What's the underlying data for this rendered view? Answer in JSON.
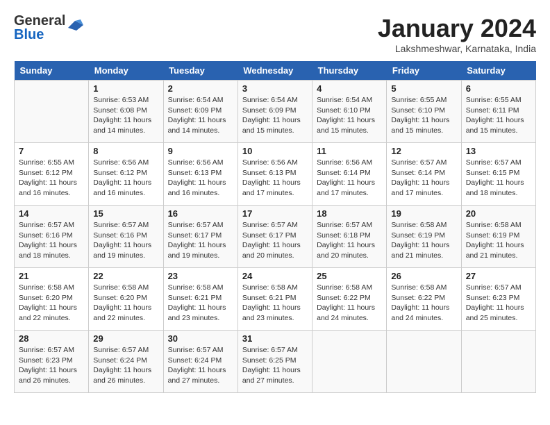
{
  "header": {
    "logo_general": "General",
    "logo_blue": "Blue",
    "month_title": "January 2024",
    "location": "Lakshmeshwar, Karnataka, India"
  },
  "weekdays": [
    "Sunday",
    "Monday",
    "Tuesday",
    "Wednesday",
    "Thursday",
    "Friday",
    "Saturday"
  ],
  "weeks": [
    [
      {
        "day": "",
        "info": ""
      },
      {
        "day": "1",
        "info": "Sunrise: 6:53 AM\nSunset: 6:08 PM\nDaylight: 11 hours\nand 14 minutes."
      },
      {
        "day": "2",
        "info": "Sunrise: 6:54 AM\nSunset: 6:09 PM\nDaylight: 11 hours\nand 14 minutes."
      },
      {
        "day": "3",
        "info": "Sunrise: 6:54 AM\nSunset: 6:09 PM\nDaylight: 11 hours\nand 15 minutes."
      },
      {
        "day": "4",
        "info": "Sunrise: 6:54 AM\nSunset: 6:10 PM\nDaylight: 11 hours\nand 15 minutes."
      },
      {
        "day": "5",
        "info": "Sunrise: 6:55 AM\nSunset: 6:10 PM\nDaylight: 11 hours\nand 15 minutes."
      },
      {
        "day": "6",
        "info": "Sunrise: 6:55 AM\nSunset: 6:11 PM\nDaylight: 11 hours\nand 15 minutes."
      }
    ],
    [
      {
        "day": "7",
        "info": "Sunrise: 6:55 AM\nSunset: 6:12 PM\nDaylight: 11 hours\nand 16 minutes."
      },
      {
        "day": "8",
        "info": "Sunrise: 6:56 AM\nSunset: 6:12 PM\nDaylight: 11 hours\nand 16 minutes."
      },
      {
        "day": "9",
        "info": "Sunrise: 6:56 AM\nSunset: 6:13 PM\nDaylight: 11 hours\nand 16 minutes."
      },
      {
        "day": "10",
        "info": "Sunrise: 6:56 AM\nSunset: 6:13 PM\nDaylight: 11 hours\nand 17 minutes."
      },
      {
        "day": "11",
        "info": "Sunrise: 6:56 AM\nSunset: 6:14 PM\nDaylight: 11 hours\nand 17 minutes."
      },
      {
        "day": "12",
        "info": "Sunrise: 6:57 AM\nSunset: 6:14 PM\nDaylight: 11 hours\nand 17 minutes."
      },
      {
        "day": "13",
        "info": "Sunrise: 6:57 AM\nSunset: 6:15 PM\nDaylight: 11 hours\nand 18 minutes."
      }
    ],
    [
      {
        "day": "14",
        "info": "Sunrise: 6:57 AM\nSunset: 6:16 PM\nDaylight: 11 hours\nand 18 minutes."
      },
      {
        "day": "15",
        "info": "Sunrise: 6:57 AM\nSunset: 6:16 PM\nDaylight: 11 hours\nand 19 minutes."
      },
      {
        "day": "16",
        "info": "Sunrise: 6:57 AM\nSunset: 6:17 PM\nDaylight: 11 hours\nand 19 minutes."
      },
      {
        "day": "17",
        "info": "Sunrise: 6:57 AM\nSunset: 6:17 PM\nDaylight: 11 hours\nand 20 minutes."
      },
      {
        "day": "18",
        "info": "Sunrise: 6:57 AM\nSunset: 6:18 PM\nDaylight: 11 hours\nand 20 minutes."
      },
      {
        "day": "19",
        "info": "Sunrise: 6:58 AM\nSunset: 6:19 PM\nDaylight: 11 hours\nand 21 minutes."
      },
      {
        "day": "20",
        "info": "Sunrise: 6:58 AM\nSunset: 6:19 PM\nDaylight: 11 hours\nand 21 minutes."
      }
    ],
    [
      {
        "day": "21",
        "info": "Sunrise: 6:58 AM\nSunset: 6:20 PM\nDaylight: 11 hours\nand 22 minutes."
      },
      {
        "day": "22",
        "info": "Sunrise: 6:58 AM\nSunset: 6:20 PM\nDaylight: 11 hours\nand 22 minutes."
      },
      {
        "day": "23",
        "info": "Sunrise: 6:58 AM\nSunset: 6:21 PM\nDaylight: 11 hours\nand 23 minutes."
      },
      {
        "day": "24",
        "info": "Sunrise: 6:58 AM\nSunset: 6:21 PM\nDaylight: 11 hours\nand 23 minutes."
      },
      {
        "day": "25",
        "info": "Sunrise: 6:58 AM\nSunset: 6:22 PM\nDaylight: 11 hours\nand 24 minutes."
      },
      {
        "day": "26",
        "info": "Sunrise: 6:58 AM\nSunset: 6:22 PM\nDaylight: 11 hours\nand 24 minutes."
      },
      {
        "day": "27",
        "info": "Sunrise: 6:57 AM\nSunset: 6:23 PM\nDaylight: 11 hours\nand 25 minutes."
      }
    ],
    [
      {
        "day": "28",
        "info": "Sunrise: 6:57 AM\nSunset: 6:23 PM\nDaylight: 11 hours\nand 26 minutes."
      },
      {
        "day": "29",
        "info": "Sunrise: 6:57 AM\nSunset: 6:24 PM\nDaylight: 11 hours\nand 26 minutes."
      },
      {
        "day": "30",
        "info": "Sunrise: 6:57 AM\nSunset: 6:24 PM\nDaylight: 11 hours\nand 27 minutes."
      },
      {
        "day": "31",
        "info": "Sunrise: 6:57 AM\nSunset: 6:25 PM\nDaylight: 11 hours\nand 27 minutes."
      },
      {
        "day": "",
        "info": ""
      },
      {
        "day": "",
        "info": ""
      },
      {
        "day": "",
        "info": ""
      }
    ]
  ]
}
